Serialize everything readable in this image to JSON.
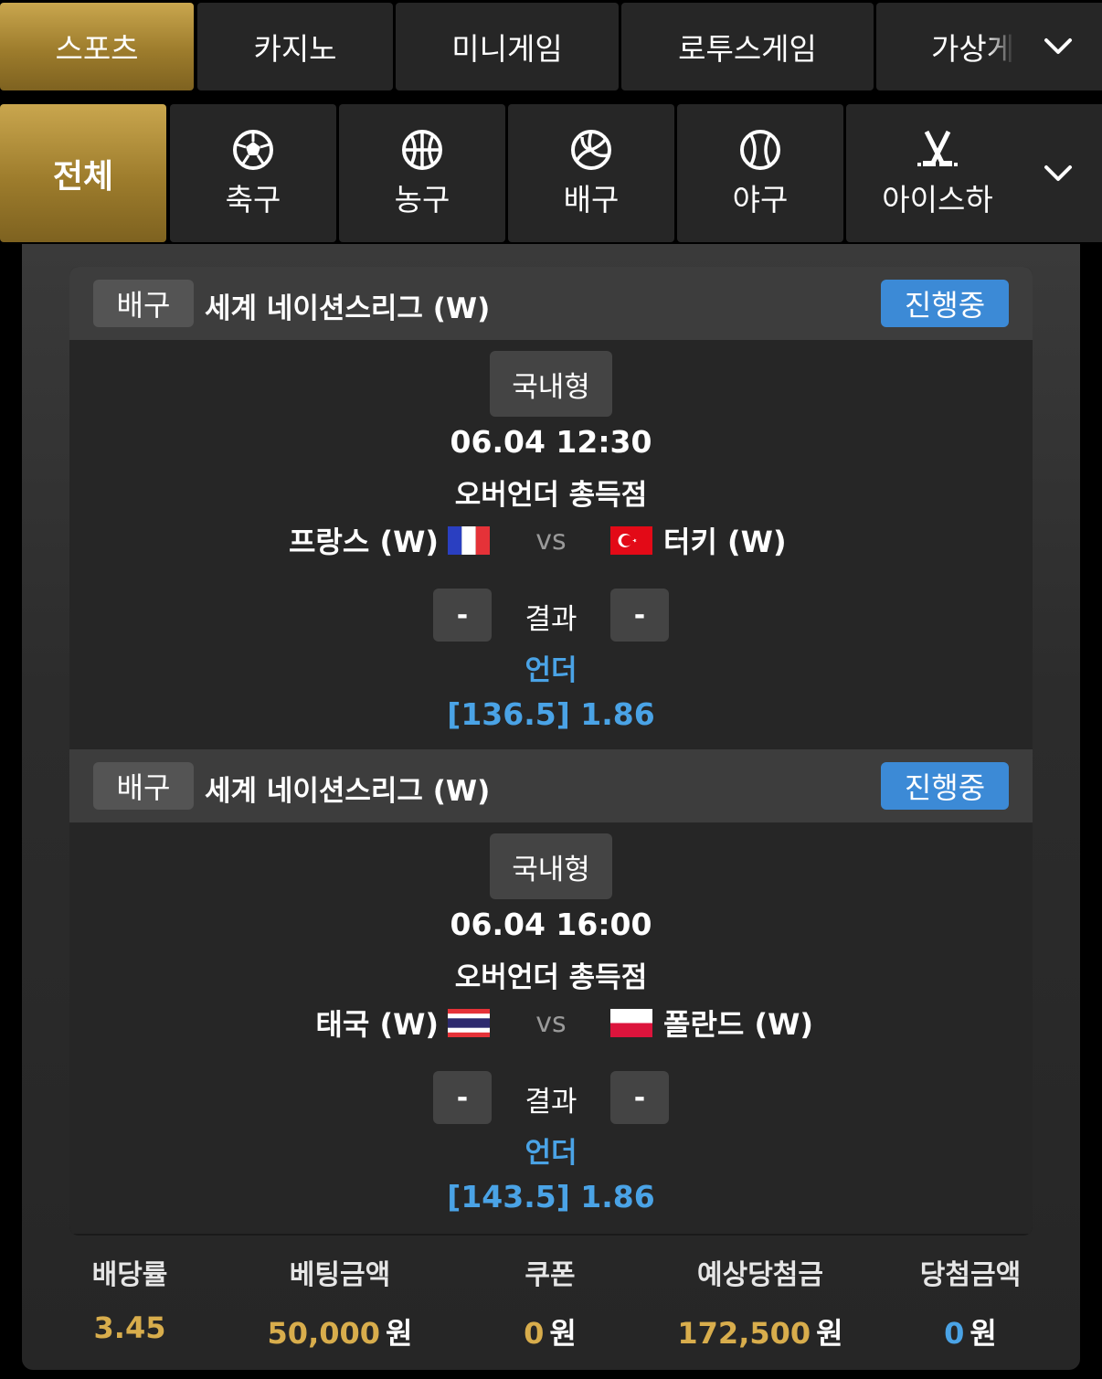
{
  "top_nav": {
    "tabs": [
      "스포츠",
      "카지노",
      "미니게임",
      "로투스게임",
      "가상게"
    ],
    "active": "스포츠"
  },
  "sport_nav": {
    "tabs": [
      {
        "label": "전체",
        "icon": "all"
      },
      {
        "label": "축구",
        "icon": "soccer-ball-icon"
      },
      {
        "label": "농구",
        "icon": "basketball-icon"
      },
      {
        "label": "배구",
        "icon": "volleyball-icon"
      },
      {
        "label": "야구",
        "icon": "baseball-icon"
      },
      {
        "label": "아이스하",
        "icon": "hockey-sticks-icon"
      }
    ]
  },
  "matches": [
    {
      "sport": "배구",
      "league": "세계 네이션스리그 (W)",
      "status": "진행중",
      "type": "국내형",
      "time": "06.04 12:30",
      "market": "오버언더 총득점",
      "home": "프랑스 (W)",
      "away": "터키 (W)",
      "vs": "vs",
      "home_score": "-",
      "away_score": "-",
      "result_label": "결과",
      "pick": "언더",
      "odds": "[136.5] 1.86"
    },
    {
      "sport": "배구",
      "league": "세계 네이션스리그 (W)",
      "status": "진행중",
      "type": "국내형",
      "time": "06.04 16:00",
      "market": "오버언더 총득점",
      "home": "태국 (W)",
      "away": "폴란드 (W)",
      "vs": "vs",
      "home_score": "-",
      "away_score": "-",
      "result_label": "결과",
      "pick": "언더",
      "odds": "[143.5] 1.86"
    }
  ],
  "summary": {
    "odds_label": "배당률",
    "odds_value": "3.45",
    "bet_label": "베팅금액",
    "bet_value": "50,000",
    "bet_unit": "원",
    "coupon_label": "쿠폰",
    "coupon_value": "0",
    "coupon_unit": "원",
    "expected_label": "예상당첨금",
    "expected_value": "172,500",
    "expected_unit": "원",
    "win_label": "당첨금액",
    "win_value": "0",
    "win_unit": "원"
  },
  "colors": {
    "gold_accent": "#c9a64e",
    "status_blue": "#3c8ad6",
    "pick_blue": "#4aa3e6",
    "amount_gold": "#d8ad4c"
  }
}
